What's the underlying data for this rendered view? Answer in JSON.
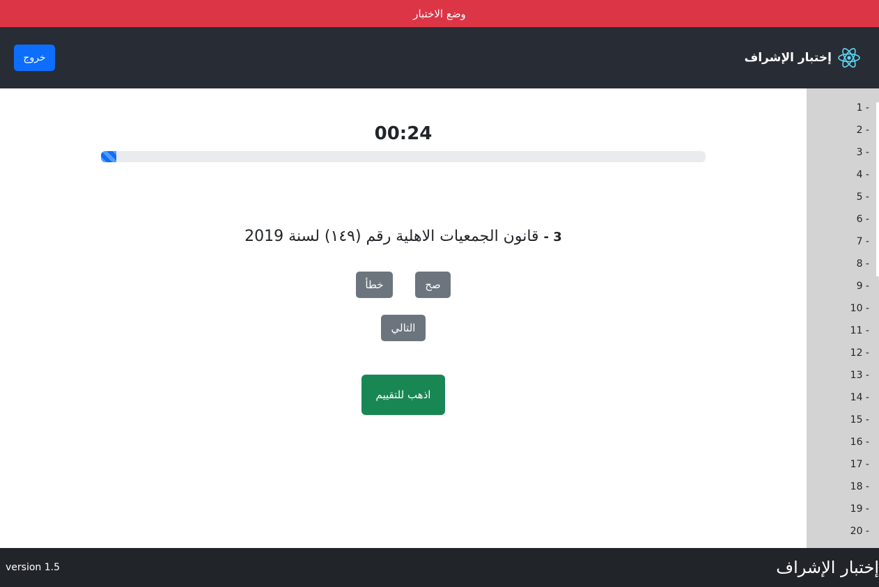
{
  "banner": {
    "text": "وضع الاختبار"
  },
  "header": {
    "logout_label": "خروج",
    "brand": "إختبار الإشراف",
    "brand_icon": "react-atom-icon",
    "accent": "#61dafb"
  },
  "quiz": {
    "timer": "00:24",
    "progress_fraction": 0.025,
    "question_number": "3 -",
    "question_text": "قانون الجمعيات الاهلية رقم (١٤٩) لسنة 2019",
    "true_label": "صح",
    "false_label": "خطأ",
    "next_label": "التالي",
    "evaluate_label": "اذهب للتقييم"
  },
  "sidebar": {
    "items": [
      "1 -",
      "2 -",
      "3 -",
      "4 -",
      "5 -",
      "6 -",
      "7 -",
      "8 -",
      "9 -",
      "10 -",
      "11 -",
      "12 -",
      "13 -",
      "14 -",
      "15 -",
      "16 -",
      "17 -",
      "18 -",
      "19 -",
      "20 -"
    ]
  },
  "footer": {
    "version": "version 1.5",
    "brand": "إختبار الإشراف"
  },
  "colors": {
    "banner": "#dc3545",
    "navbar": "#282c34",
    "primary": "#0d6efd",
    "secondary": "#6c757d",
    "success": "#198754",
    "sidebar": "#d3d3d3",
    "footer": "#212529"
  }
}
